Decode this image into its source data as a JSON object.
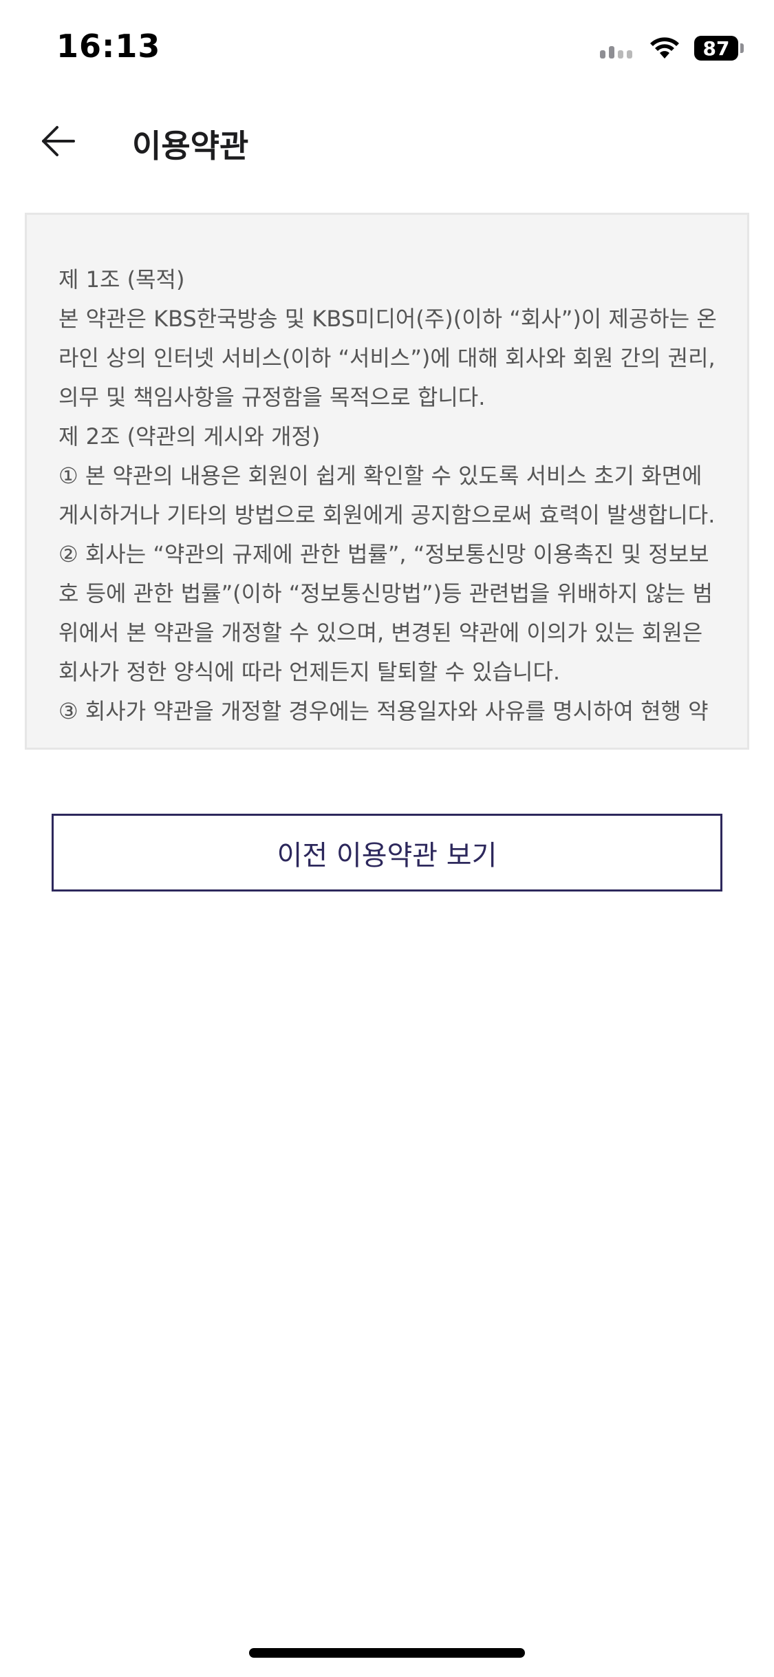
{
  "status_bar": {
    "time": "16:13",
    "battery": "87",
    "icons": [
      "cellular-signal-icon",
      "wifi-icon",
      "battery-icon"
    ]
  },
  "header": {
    "back_icon": "arrow-left-icon",
    "title": "이용약관"
  },
  "terms": {
    "lines": [
      "제 1조 (목적)",
      "본 약관은 KBS한국방송 및 KBS미디어(주)(이하 “회사”)이 제공하는 온",
      "라인 상의 인터넷 서비스(이하 “서비스”)에 대해 회사와 회원 간의 권리,",
      "의무 및 책임사항을 규정함을 목적으로 합니다.",
      "제 2조 (약관의 게시와 개정)",
      "① 본 약관의 내용은 회원이 쉽게 확인할 수 있도록 서비스 초기 화면에",
      "게시하거나 기타의 방법으로 회원에게 공지함으로써 효력이 발생합니다.",
      "② 회사는 “약관의 규제에 관한 법률”, “정보통신망 이용촉진 및 정보보",
      "호 등에 관한 법률”(이하 “정보통신망법”)등 관련법을 위배하지 않는 범",
      "위에서 본 약관을 개정할 수 있으며, 변경된 약관에 이의가 있는 회원은",
      "회사가 정한 양식에 따라 언제든지 탈퇴할 수 있습니다.",
      "③ 회사가 약관을 개정할 경우에는 적용일자와 사유를 명시하여 현행 약"
    ]
  },
  "prev_terms_button": {
    "label": "이전 이용약관 보기"
  },
  "colors": {
    "accent": "#2d285c",
    "terms_background": "#f4f4f4",
    "terms_text": "#555555"
  }
}
